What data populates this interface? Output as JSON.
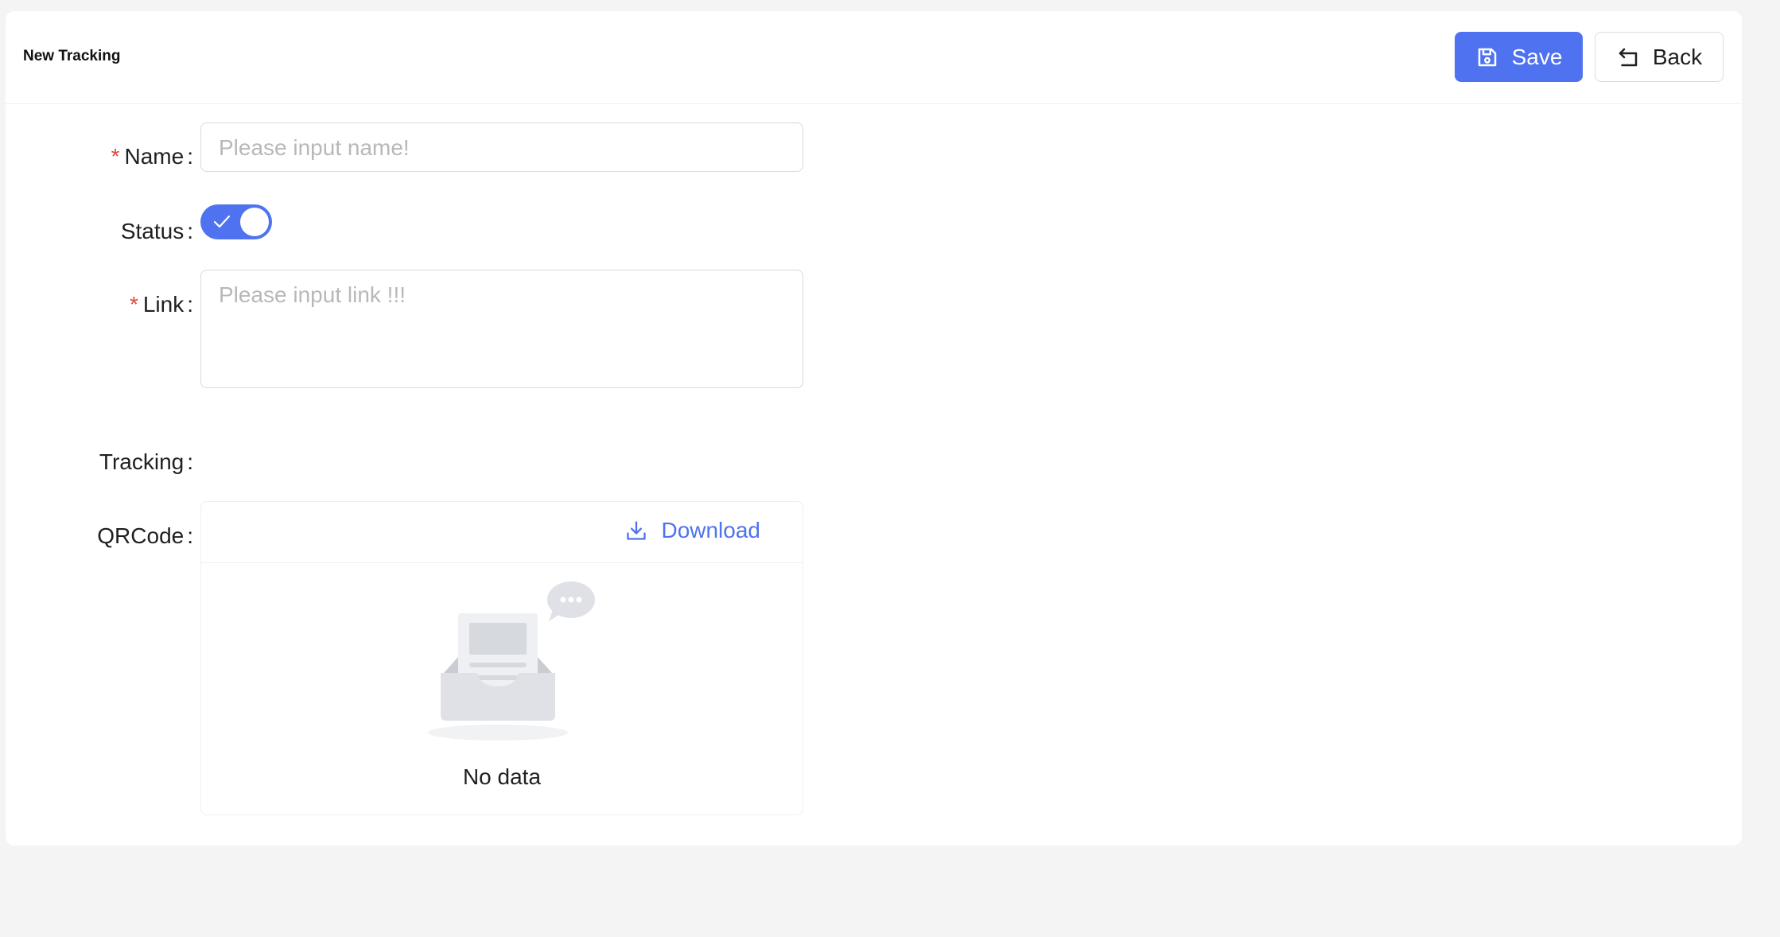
{
  "header": {
    "title": "New Tracking",
    "save_label": "Save",
    "back_label": "Back",
    "save_icon": "save-icon",
    "back_icon": "back-arrow-icon"
  },
  "form": {
    "name": {
      "label": "Name",
      "required": true,
      "placeholder": "Please input name!",
      "value": ""
    },
    "status": {
      "label": "Status",
      "checked": true
    },
    "link": {
      "label": "Link",
      "required": true,
      "placeholder": "Please input link !!!",
      "value": ""
    },
    "tracking": {
      "label": "Tracking",
      "value": ""
    },
    "qrcode": {
      "label": "QRCode",
      "download_label": "Download",
      "empty_text": "No data"
    }
  },
  "colors": {
    "accent": "#4f72f0",
    "required": "#e0473e",
    "background": "#f4f4f4"
  }
}
